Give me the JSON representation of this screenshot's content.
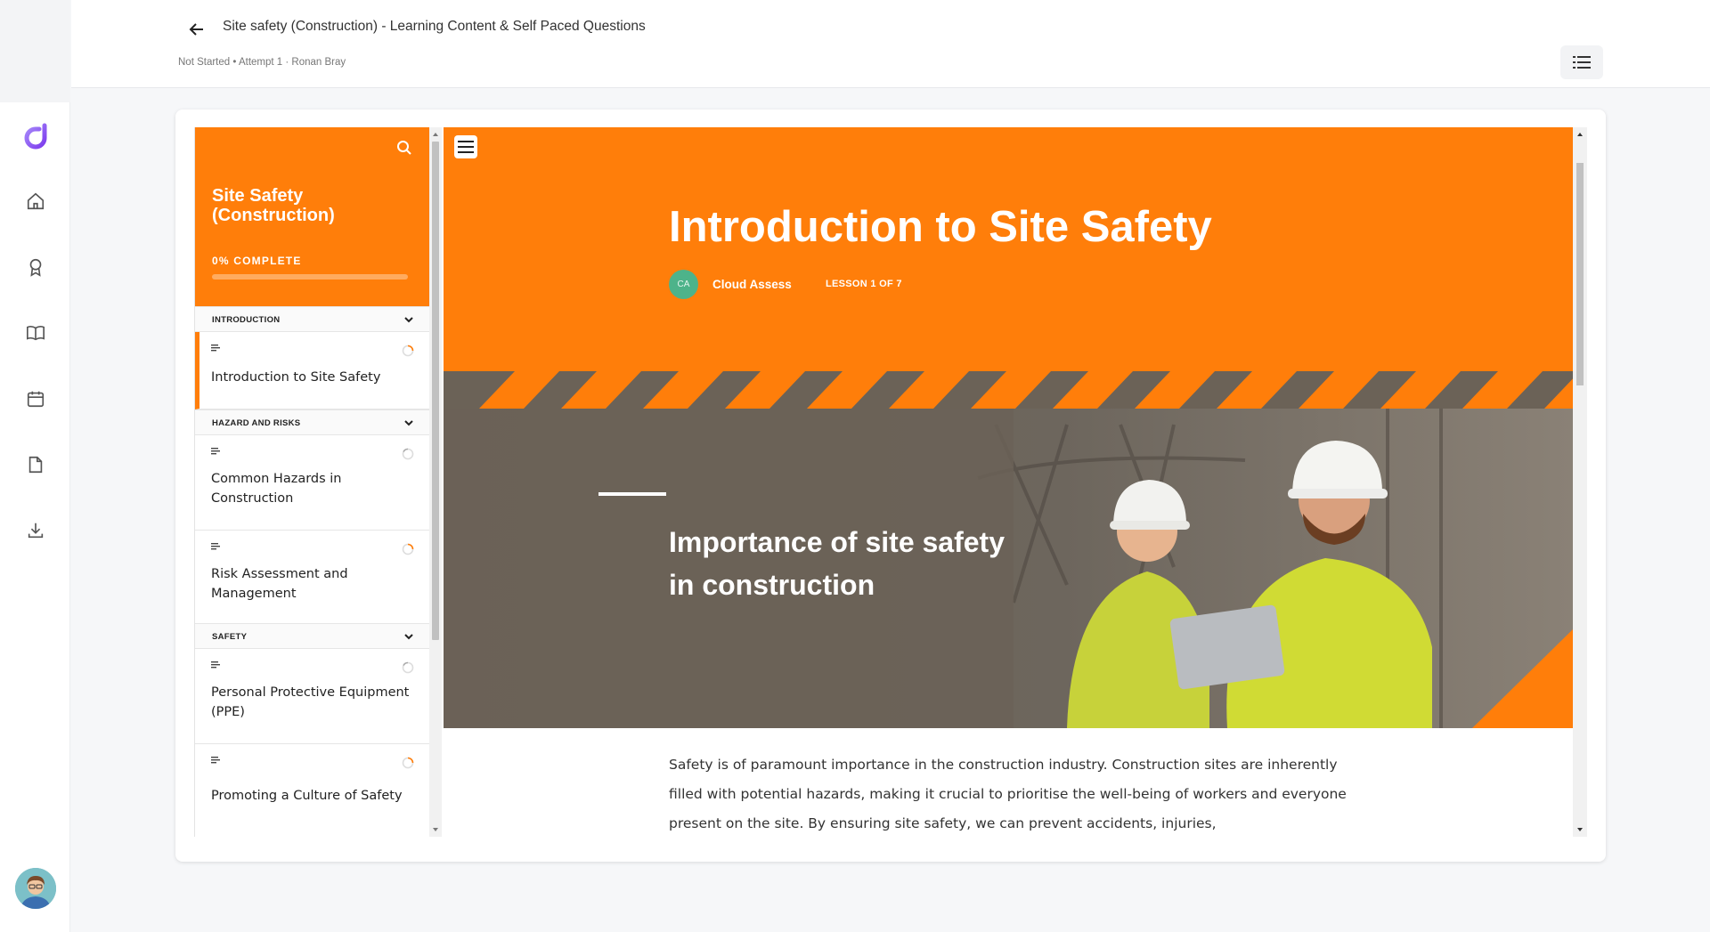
{
  "header": {
    "title": "Site safety (Construction) - Learning Content & Self Paced Questions",
    "subtitle": "Not Started • Attempt 1 · Ronan Bray"
  },
  "rail": {
    "icons": [
      "app-logo-icon",
      "home-icon",
      "award-icon",
      "book-icon",
      "calendar-icon",
      "document-icon",
      "download-icon"
    ]
  },
  "course": {
    "title": "Site Safety (Construction)",
    "progress_label": "0% COMPLETE",
    "progress": 0,
    "sections": [
      {
        "name": "INTRODUCTION",
        "lessons": [
          {
            "title": "Introduction to Site Safety",
            "active": true
          }
        ]
      },
      {
        "name": "HAZARD AND RISKS",
        "lessons": [
          {
            "title": "Common Hazards in Construction"
          },
          {
            "title": "Risk Assessment and Management"
          }
        ]
      },
      {
        "name": "SAFETY",
        "lessons": [
          {
            "title": "Personal Protective Equipment (PPE)"
          },
          {
            "title": "Promoting a Culture of Safety"
          }
        ]
      }
    ]
  },
  "lesson": {
    "title": "Introduction to Site Safety",
    "author_initials": "CA",
    "author": "Cloud Assess",
    "lesson_count": "LESSON 1 OF 7",
    "banner_heading": "Importance of site safety in construction",
    "body": "Safety is of paramount importance in the construction industry. Construction sites are inherently filled with potential hazards, making it crucial to prioritise the well-being of workers and everyone present on the site. By ensuring site safety, we can prevent accidents, injuries,"
  },
  "colors": {
    "accent": "#ff7e0a",
    "banner": "#6b6257",
    "brand_logo": "#8b5cf6"
  }
}
